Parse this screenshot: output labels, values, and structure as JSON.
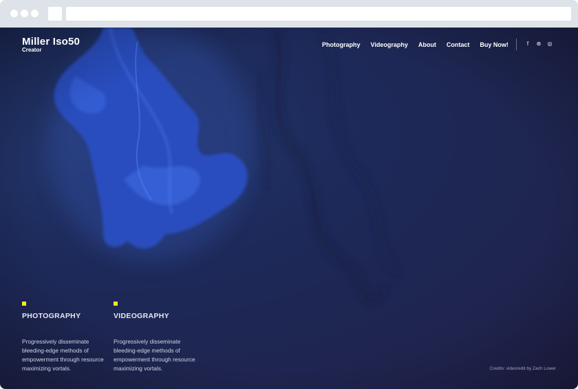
{
  "brand": {
    "name": "Miller Iso50",
    "subtitle": "Creator"
  },
  "nav": {
    "items": [
      {
        "label": "Photography"
      },
      {
        "label": "Videography"
      },
      {
        "label": "About"
      },
      {
        "label": "Contact"
      },
      {
        "label": "Buy Now!"
      }
    ]
  },
  "social": [
    {
      "icon": "facebook-icon",
      "glyph": "f"
    },
    {
      "icon": "dribbble-icon",
      "glyph": "⊛"
    },
    {
      "icon": "instagram-icon",
      "glyph": "◎"
    }
  ],
  "features": [
    {
      "title": "PHOTOGRAPHY",
      "description": "Progressively disseminate bleeding-edge methods of empowerment through resource maximizing vortals."
    },
    {
      "title": "VIDEOGRAPHY",
      "description": "Progressively disseminate bleeding-edge methods of empowerment through resource maximizing vortals."
    }
  ],
  "credits": "Credits: video/edit by Zach Lower",
  "colors": {
    "accent": "#f4ea2a",
    "background": "#1e2652",
    "ink": "#2f55c8"
  }
}
